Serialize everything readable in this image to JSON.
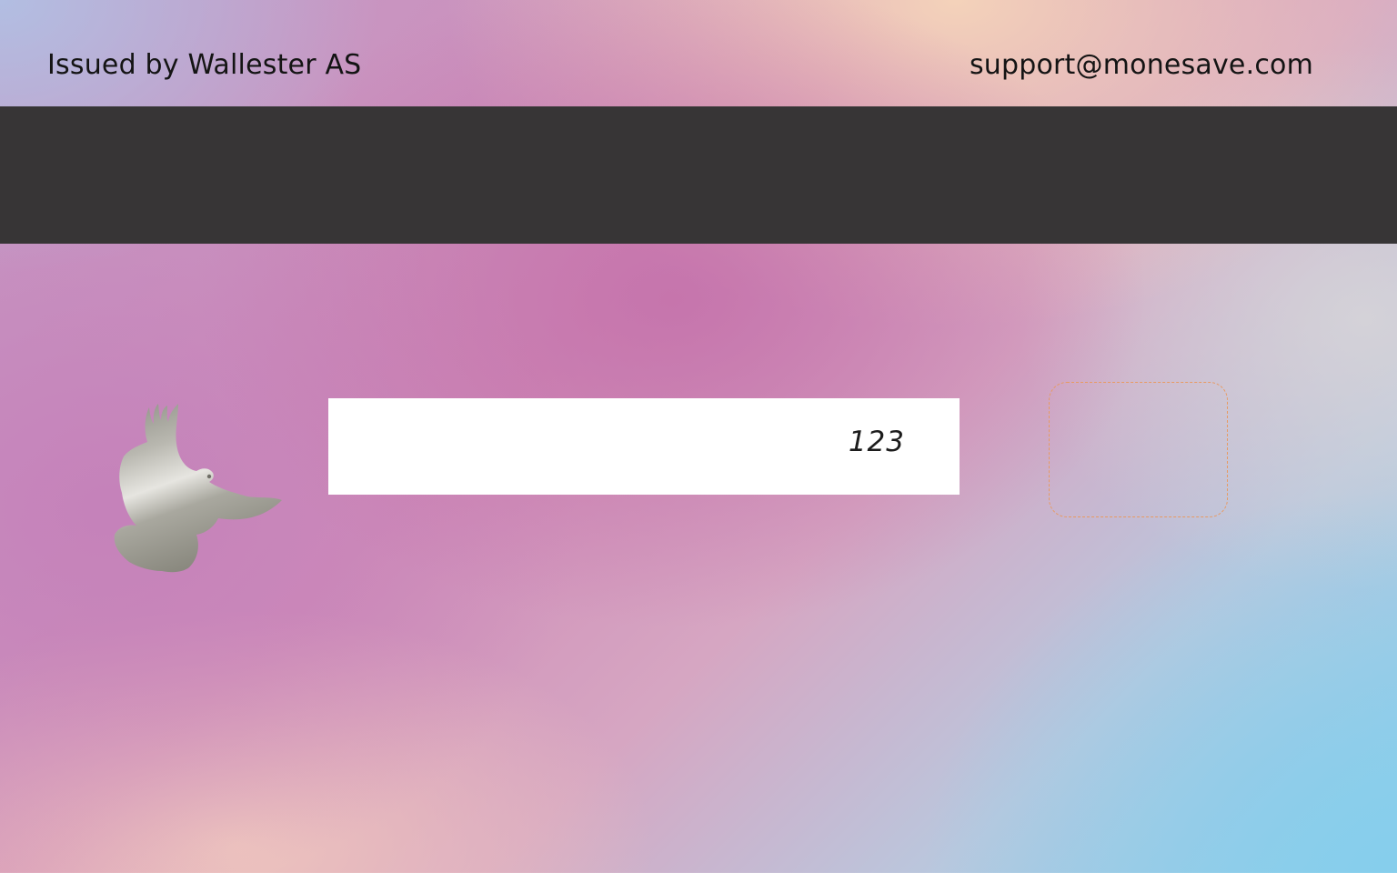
{
  "card_back": {
    "issuer_text": "Issued by Wallester AS",
    "support_email": "support@monesave.com",
    "cvv": "123",
    "logo_icon": "dove-icon",
    "colors": {
      "magnetic_stripe": "#373536",
      "signature_strip": "#ffffff",
      "hologram_outline": "#e89a62",
      "text": "#141414"
    }
  }
}
